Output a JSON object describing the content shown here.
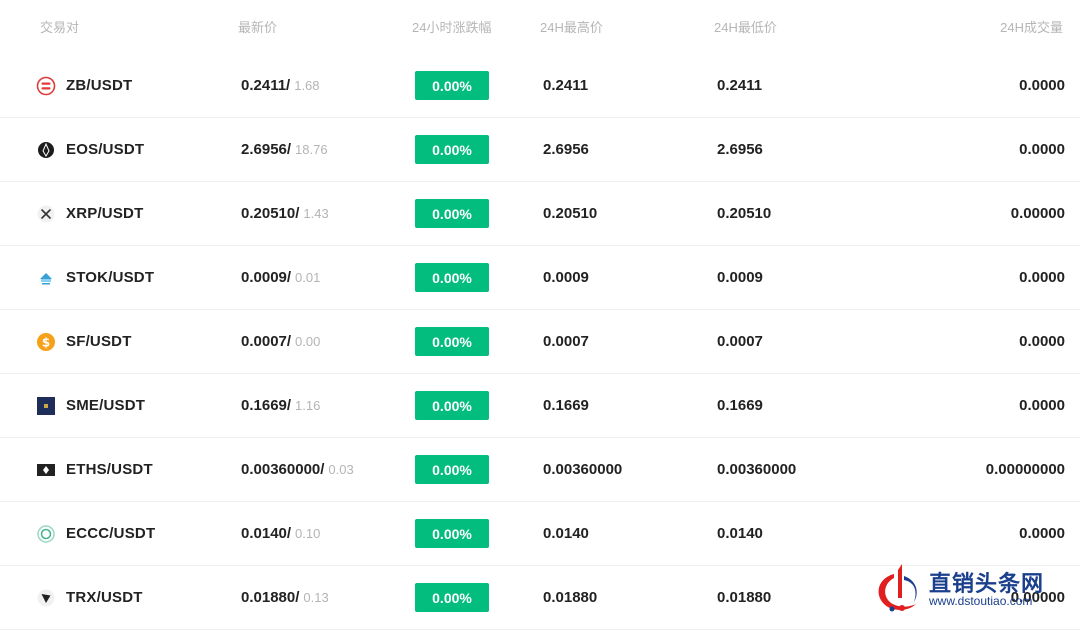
{
  "header": {
    "pair": "交易对",
    "last": "最新价",
    "change": "24小时涨跌幅",
    "high": "24H最高价",
    "low": "24H最低价",
    "volume": "24H成交量"
  },
  "rows": [
    {
      "pair": "ZB/USDT",
      "icon": "zb-coin-icon",
      "last": "0.2411/",
      "last_sub": "1.68",
      "change": "0.00%",
      "high": "0.2411",
      "low": "0.2411",
      "volume": "0.0000"
    },
    {
      "pair": "EOS/USDT",
      "icon": "eos-coin-icon",
      "last": "2.6956/",
      "last_sub": "18.76",
      "change": "0.00%",
      "high": "2.6956",
      "low": "2.6956",
      "volume": "0.0000"
    },
    {
      "pair": "XRP/USDT",
      "icon": "xrp-coin-icon",
      "last": "0.20510/",
      "last_sub": "1.43",
      "change": "0.00%",
      "high": "0.20510",
      "low": "0.20510",
      "volume": "0.00000"
    },
    {
      "pair": "STOK/USDT",
      "icon": "stok-coin-icon",
      "last": "0.0009/",
      "last_sub": "0.01",
      "change": "0.00%",
      "high": "0.0009",
      "low": "0.0009",
      "volume": "0.0000"
    },
    {
      "pair": "SF/USDT",
      "icon": "sf-coin-icon",
      "last": "0.0007/",
      "last_sub": "0.00",
      "change": "0.00%",
      "high": "0.0007",
      "low": "0.0007",
      "volume": "0.0000"
    },
    {
      "pair": "SME/USDT",
      "icon": "sme-coin-icon",
      "last": "0.1669/",
      "last_sub": "1.16",
      "change": "0.00%",
      "high": "0.1669",
      "low": "0.1669",
      "volume": "0.0000"
    },
    {
      "pair": "ETHS/USDT",
      "icon": "eths-coin-icon",
      "last": "0.00360000/",
      "last_sub": "0.03",
      "change": "0.00%",
      "high": "0.00360000",
      "low": "0.00360000",
      "volume": "0.00000000"
    },
    {
      "pair": "ECCC/USDT",
      "icon": "eccc-coin-icon",
      "last": "0.0140/",
      "last_sub": "0.10",
      "change": "0.00%",
      "high": "0.0140",
      "low": "0.0140",
      "volume": "0.0000"
    },
    {
      "pair": "TRX/USDT",
      "icon": "trx-coin-icon",
      "last": "0.01880/",
      "last_sub": "0.13",
      "change": "0.00%",
      "high": "0.01880",
      "low": "0.01880",
      "volume": "0.00000"
    }
  ],
  "colors": {
    "positive_badge": "#03bd7f",
    "header_text": "#b6b6b6",
    "primary_text": "#222222"
  },
  "watermark": {
    "title": "直销头条网",
    "url": "www.dstoutiao.com"
  }
}
